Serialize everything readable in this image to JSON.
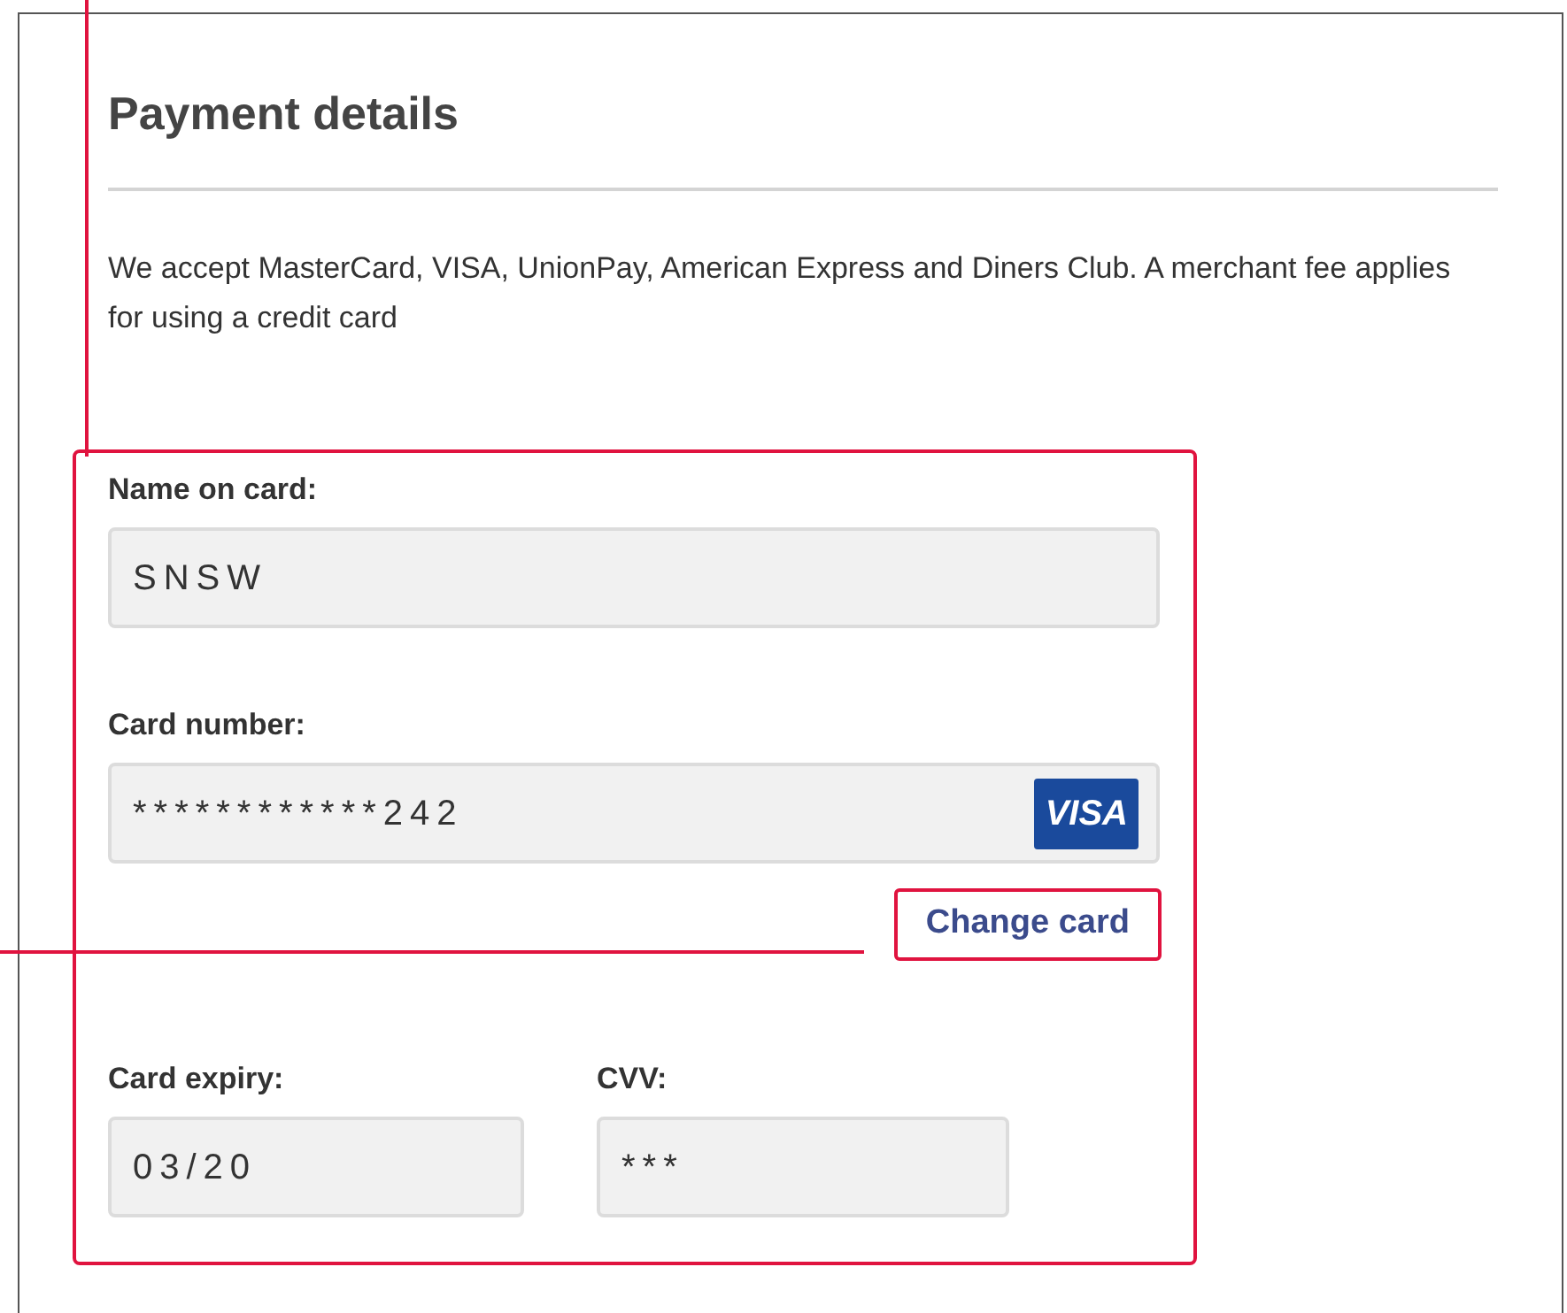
{
  "heading": "Payment details",
  "description": "We accept MasterCard, VISA, UnionPay, American Express and Diners Club. A merchant fee applies for using a credit card",
  "name_field": {
    "label": "Name on card:",
    "value": "SNSW"
  },
  "card_number_field": {
    "label": "Card number:",
    "value": "************242",
    "brand": "VISA"
  },
  "change_card_link": "Change card",
  "expiry_field": {
    "label": "Card expiry:",
    "value": "03/20"
  },
  "cvv_field": {
    "label": "CVV:",
    "value": "***"
  }
}
